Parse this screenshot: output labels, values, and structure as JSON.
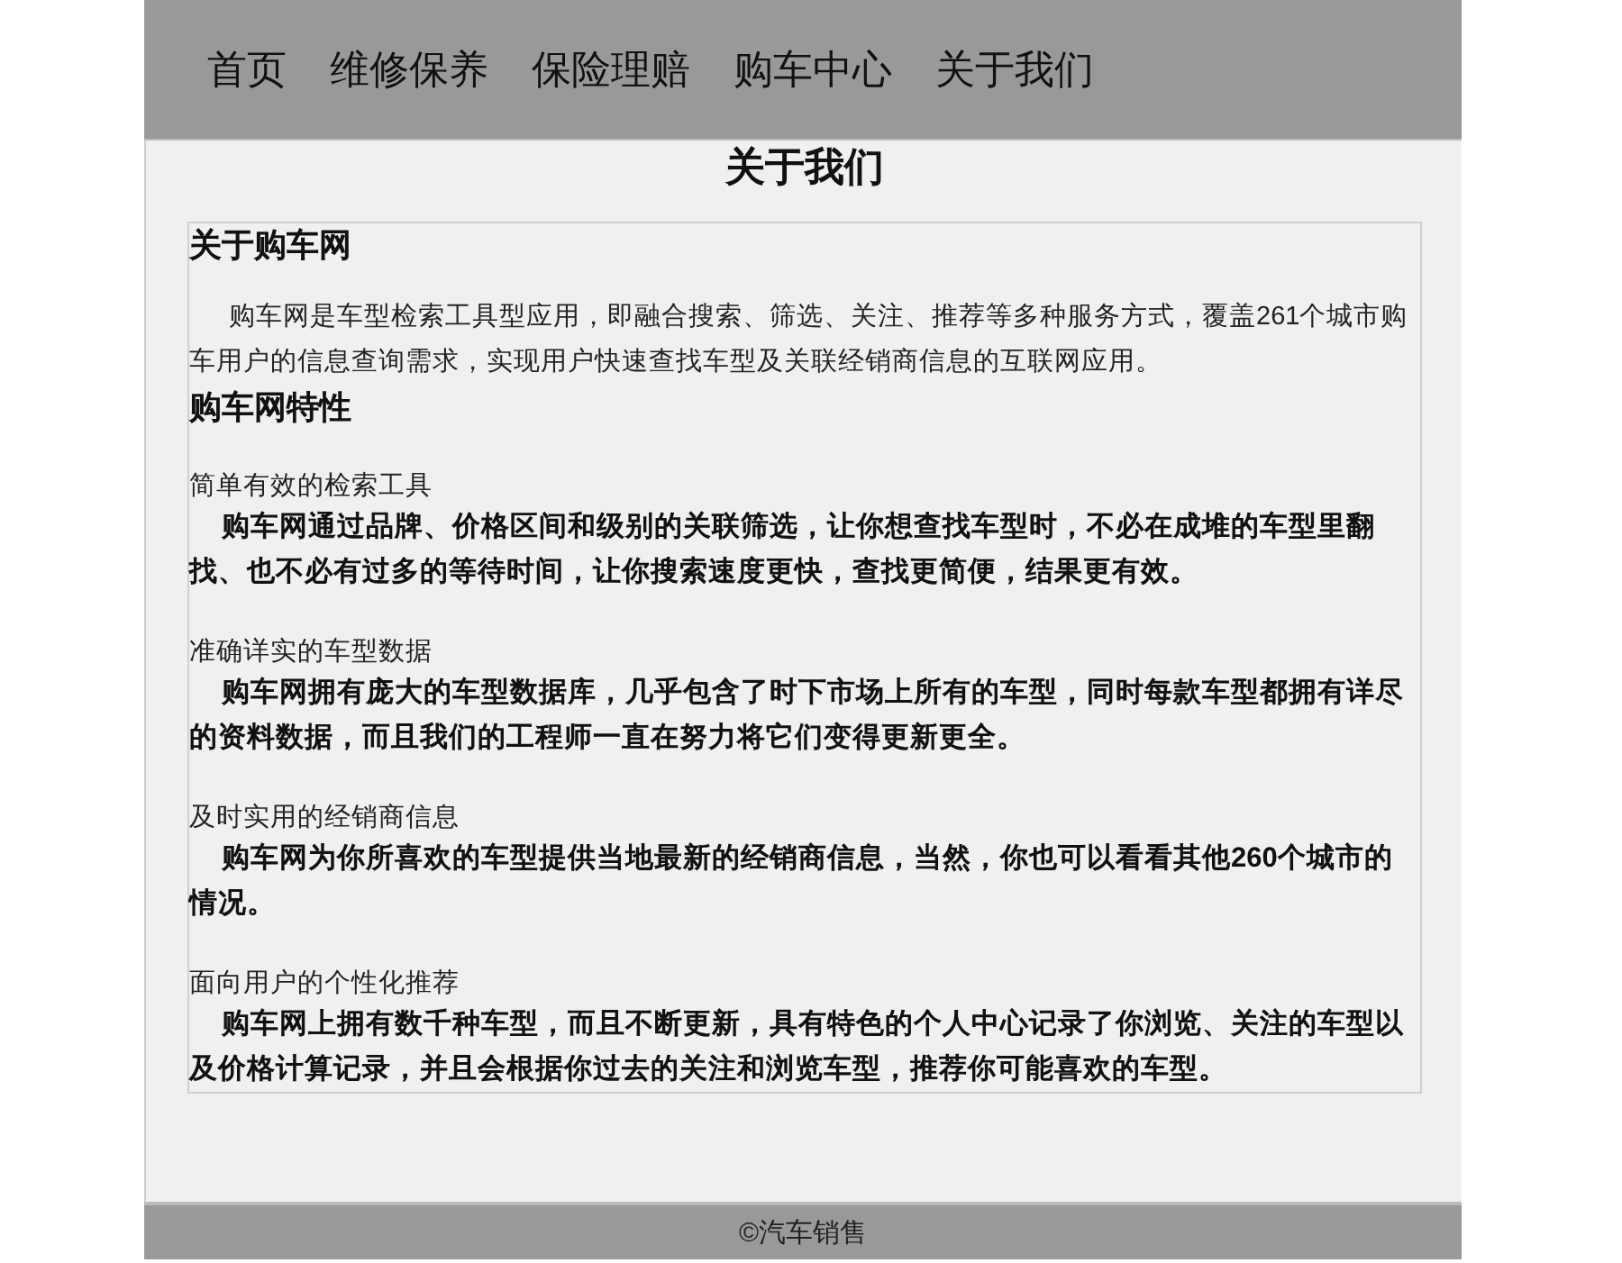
{
  "nav": {
    "items": [
      "首页",
      "维修保养",
      "保险理赔",
      "购车中心",
      "关于我们"
    ]
  },
  "page_title": "关于我们",
  "about": {
    "heading": "关于购车网",
    "intro": "购车网是车型检索工具型应用，即融合搜索、筛选、关注、推荐等多种服务方式，覆盖261个城市购车用户的信息查询需求，实现用户快速查找车型及关联经销商信息的互联网应用。"
  },
  "features": {
    "heading": "购车网特性",
    "items": [
      {
        "title": "简单有效的检索工具",
        "text": "购车网通过品牌、价格区间和级别的关联筛选，让你想查找车型时，不必在成堆的车型里翻找、也不必有过多的等待时间，让你搜索速度更快，查找更简便，结果更有效。"
      },
      {
        "title": "准确详实的车型数据",
        "text": "购车网拥有庞大的车型数据库，几乎包含了时下市场上所有的车型，同时每款车型都拥有详尽的资料数据，而且我们的工程师一直在努力将它们变得更新更全。"
      },
      {
        "title": "及时实用的经销商信息",
        "text": "购车网为你所喜欢的车型提供当地最新的经销商信息，当然，你也可以看看其他260个城市的情况。"
      },
      {
        "title": "面向用户的个性化推荐",
        "text": "购车网上拥有数千种车型，而且不断更新，具有特色的个人中心记录了你浏览、关注的车型以及价格计算记录，并且会根据你过去的关注和浏览车型，推荐你可能喜欢的车型。"
      }
    ]
  },
  "footer": "©汽车销售"
}
